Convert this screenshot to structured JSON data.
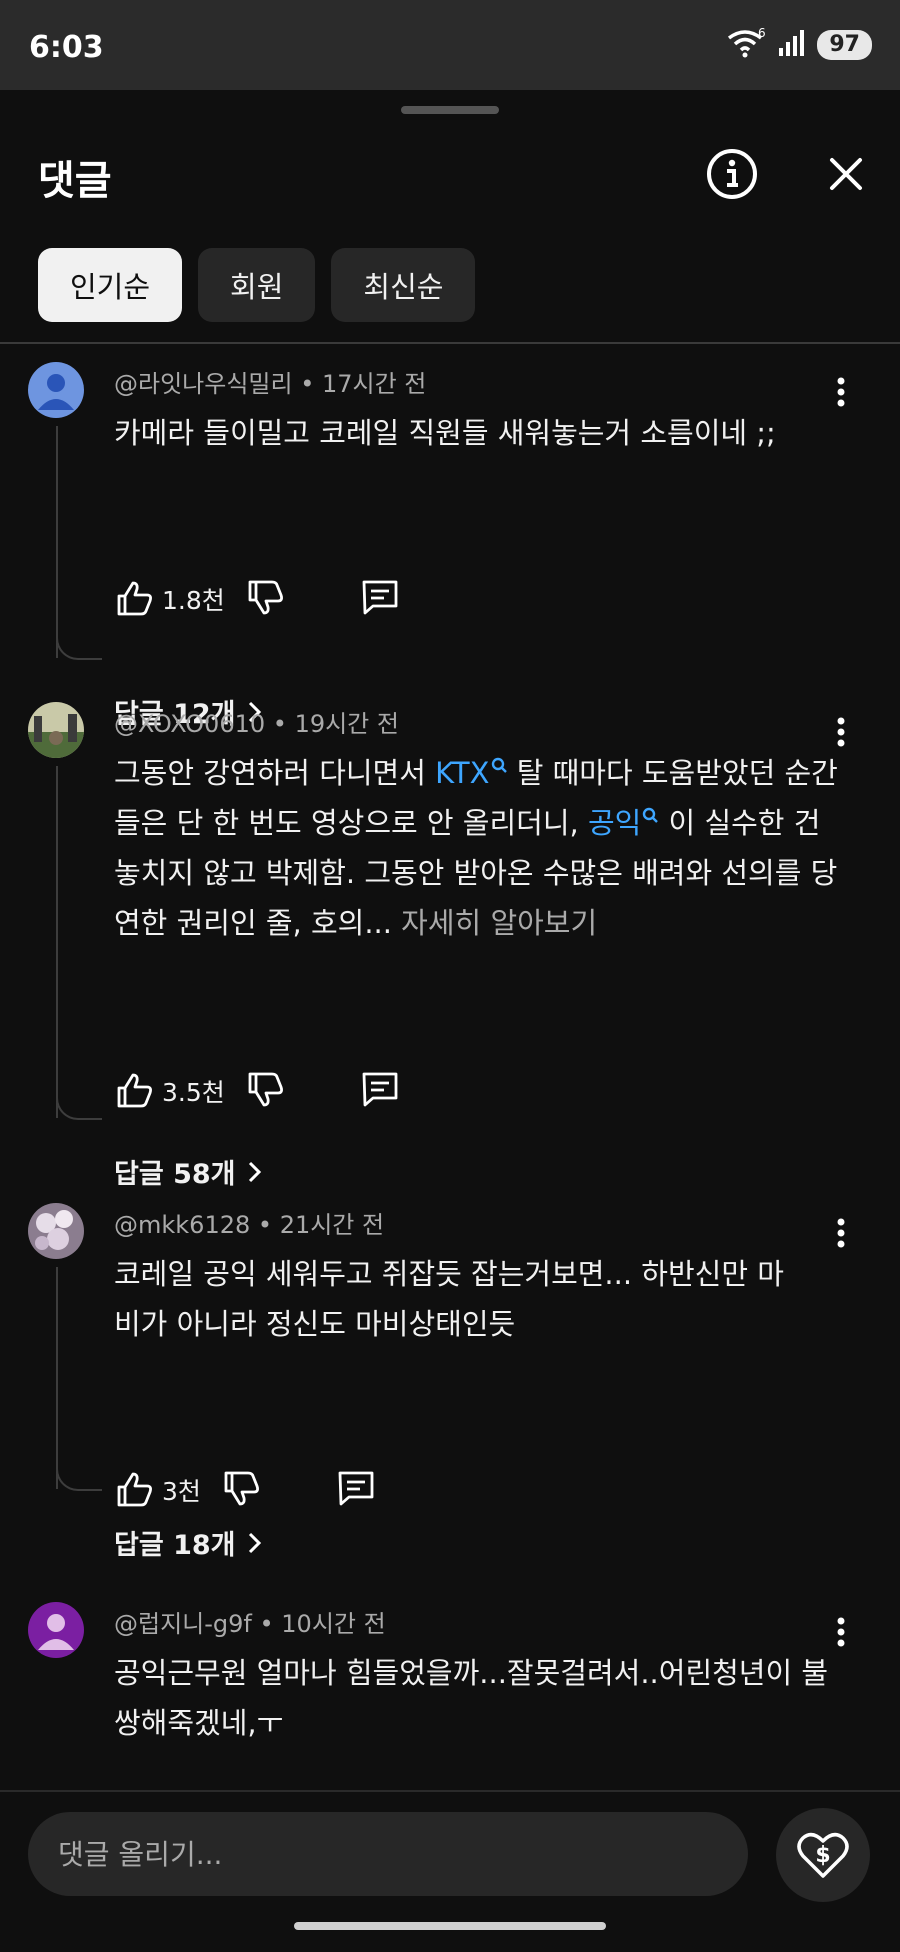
{
  "status": {
    "time": "6:03",
    "wifi_badge": "6",
    "battery": "97"
  },
  "header": {
    "title": "댓글"
  },
  "filters": [
    "인기순",
    "회원",
    "최신순"
  ],
  "comments": [
    {
      "author": "@라잇나우식밀리",
      "time": "17시간 전",
      "text": "카메라 들이밀고 코레일 직원들 새워놓는거 소름이네 ;;",
      "likes": "1.8천",
      "replies": "답글 12개"
    },
    {
      "author": "@XOXO0610",
      "time": "19시간 전",
      "text_parts": {
        "t1": "그동안 강연하러 다니면서 ",
        "link1": "KTX",
        "t2": " 탈 때마다 도움받았던 순간들은 단 한 번도 영상으로 안 올리더니, ",
        "link2": "공익",
        "t3": " 이 실수한 건 놓치지 않고 박제함. 그동안 받아온 수많은 배려와 선의를 당연한 권리인 줄, 호의...",
        "more": " 자세히 알아보기"
      },
      "likes": "3.5천",
      "replies": "답글 58개"
    },
    {
      "author": "@mkk6128",
      "time": "21시간 전",
      "text": "코레일 공익 세워두고 쥐잡듯 잡는거보면... 하반신만 마비가 아니라 정신도 마비상태인듯",
      "likes": "3천",
      "replies": "답글 18개"
    },
    {
      "author": "@럽지니-g9f",
      "time": "10시간 전",
      "text": "공익근무원 얼마나 힘들었을까...잘못걸려서..어린청년이 불쌍해죽겠네,ㅜ",
      "likes": "",
      "replies": ""
    }
  ],
  "composer": {
    "placeholder": "댓글 올리기..."
  },
  "colors": {
    "background": "#0f0f0f",
    "link": "#3ea6ff",
    "muted": "#aaaaaa",
    "chip": "#272727"
  }
}
